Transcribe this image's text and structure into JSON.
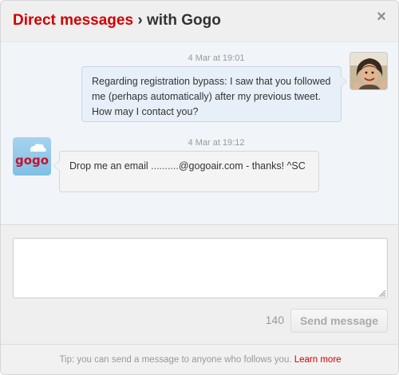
{
  "header": {
    "title_accent": "Direct messages",
    "title_sep": " › ",
    "title_rest": "with Gogo",
    "close_label": "×"
  },
  "thread": {
    "messages": [
      {
        "timestamp": "4 Mar at 19:01",
        "direction": "outgoing",
        "text": "Regarding registration bypass: I saw that you followed me (perhaps automatically) after my previous tweet. How may I contact you?",
        "avatar_icon": "user-photo-icon"
      },
      {
        "timestamp": "4 Mar at 19:12",
        "direction": "incoming",
        "text_before": "Drop me an email ",
        "text_redacted": "..........",
        "text_after": "@gogoair.com - thanks! ^SC",
        "avatar_icon": "gogo-logo-icon",
        "avatar_label": "gogo"
      }
    ]
  },
  "compose": {
    "value": "",
    "placeholder": "",
    "char_count": "140",
    "send_label": "Send message"
  },
  "footer": {
    "tip": "Tip: you can send a message to anyone who follows you. ",
    "link": "Learn more"
  },
  "colors": {
    "accent": "#d40000",
    "thread_bg": "#f1f5f9",
    "outgoing_bubble": "#e7f0f8",
    "incoming_bubble": "#f4f4f4",
    "gogo_brand": "#c8102e"
  }
}
